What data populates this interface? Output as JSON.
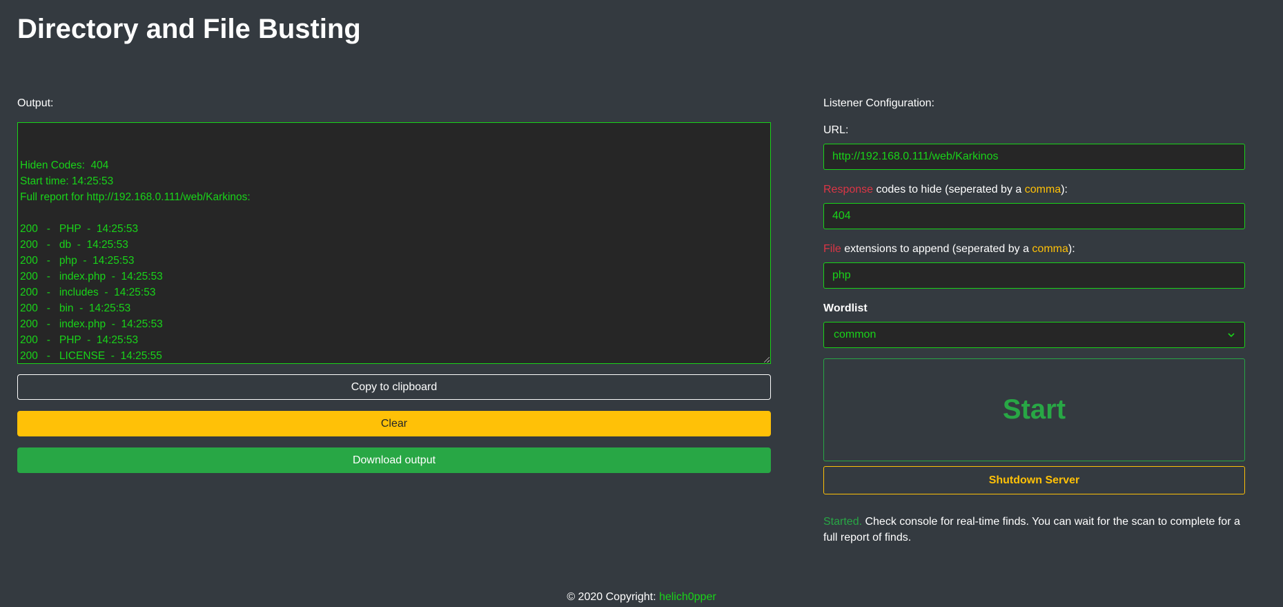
{
  "page": {
    "title": "Directory and File Busting"
  },
  "output": {
    "label": "Output:",
    "lines": [
      "Hiden Codes:  404",
      "Start time: 14:25:53",
      "Full report for http://192.168.0.111/web/Karkinos:",
      "",
      "200   -   PHP  -  14:25:53",
      "200   -   db  -  14:25:53",
      "200   -   php  -  14:25:53",
      "200   -   index.php  -  14:25:53",
      "200   -   includes  -  14:25:53",
      "200   -   bin  -  14:25:53",
      "200   -   index.php  -  14:25:53",
      "200   -   PHP  -  14:25:53",
      "200   -   LICENSE  -  14:25:55"
    ],
    "copy_label": "Copy to clipboard",
    "clear_label": "Clear",
    "download_label": "Download output"
  },
  "config": {
    "heading": "Listener Configuration:",
    "url_label": "URL:",
    "url_value": "http://192.168.0.111/web/Karkinos",
    "codes_label_highlight": "Response",
    "codes_label_text": " codes to hide (seperated by a ",
    "codes_label_comma": "comma",
    "codes_label_end": "):",
    "codes_value": "404",
    "ext_label_highlight": "File",
    "ext_label_text": " extensions to append (seperated by a ",
    "ext_label_comma": "comma",
    "ext_label_end": "):",
    "ext_value": "php",
    "wordlist_label": "Wordlist",
    "wordlist_selected": "common",
    "start_label": "Start",
    "shutdown_label": "Shutdown Server",
    "status_prefix": "Started.",
    "status_text": " Check console for real-time finds. You can wait for the scan to complete for a full report of finds."
  },
  "footer": {
    "copyright": "© 2020 Copyright: ",
    "author": "helich0pper"
  },
  "colors": {
    "background": "#343a40",
    "terminal_green": "#19d419",
    "success": "#28a745",
    "warning": "#ffc107",
    "danger": "#dc3545"
  }
}
